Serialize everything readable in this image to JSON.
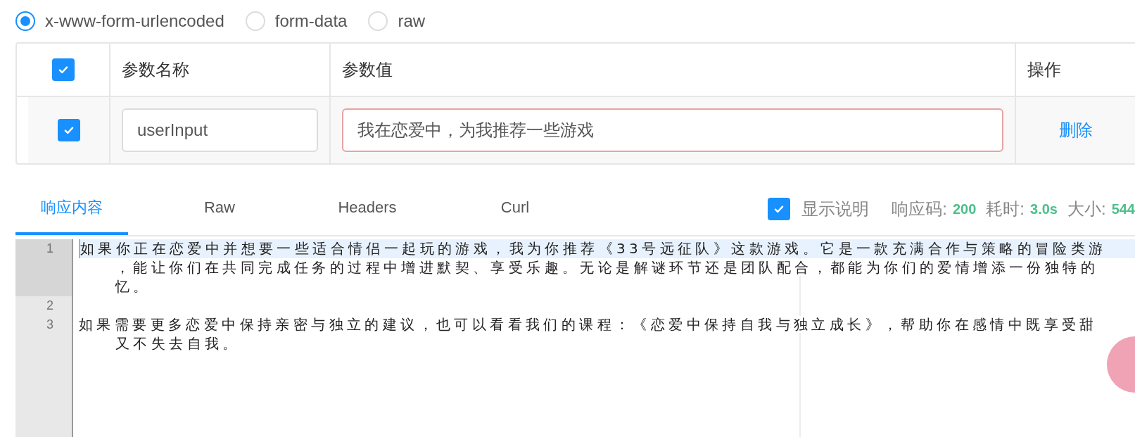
{
  "body_types": [
    {
      "label": "x-www-form-urlencoded",
      "selected": true
    },
    {
      "label": "form-data",
      "selected": false
    },
    {
      "label": "raw",
      "selected": false
    }
  ],
  "params_table": {
    "header_checkbox": {
      "checked": true
    },
    "columns": [
      "参数名称",
      "参数值",
      "操作"
    ],
    "rows": [
      {
        "enabled": true,
        "name": "userInput",
        "value": "我在恋爱中，为我推荐一些游戏",
        "value_invalid": true,
        "action": "删除"
      }
    ]
  },
  "response_tabs": [
    {
      "label": "响应内容",
      "selected": true
    },
    {
      "label": "Raw",
      "selected": false
    },
    {
      "label": "Headers",
      "selected": false
    },
    {
      "label": "Curl",
      "selected": false
    }
  ],
  "show_description": {
    "label": "显示说明",
    "checked": true
  },
  "stats": [
    {
      "label": "响应码:",
      "value": "200"
    },
    {
      "label": "耗时:",
      "value": "3.0s"
    },
    {
      "label": "大小:",
      "value": "544"
    }
  ],
  "editor": {
    "lines": [
      {
        "number": "1",
        "active": true,
        "rows": [
          "如果你正在恋爱中并想要一些适合情侣一起玩的游戏，我为你推荐《33号远征队》这款游戏。它是一款充满合作与策略的冒险类游",
          "，能让你们在共同完成任务的过程中增进默契、享受乐趣。无论是解谜环节还是团队配合，都能为你们的爱情增添一份独特的",
          "忆。"
        ]
      },
      {
        "number": "2",
        "active": false
      },
      {
        "number": "3",
        "active": false,
        "rows": [
          "如果需要更多恋爱中保持亲密与独立的建议，也可以看看我们的课程：《恋爱中保持自我与独立成长》，帮助你在感情中既享受甜",
          "又不失去自我。"
        ]
      }
    ]
  }
}
